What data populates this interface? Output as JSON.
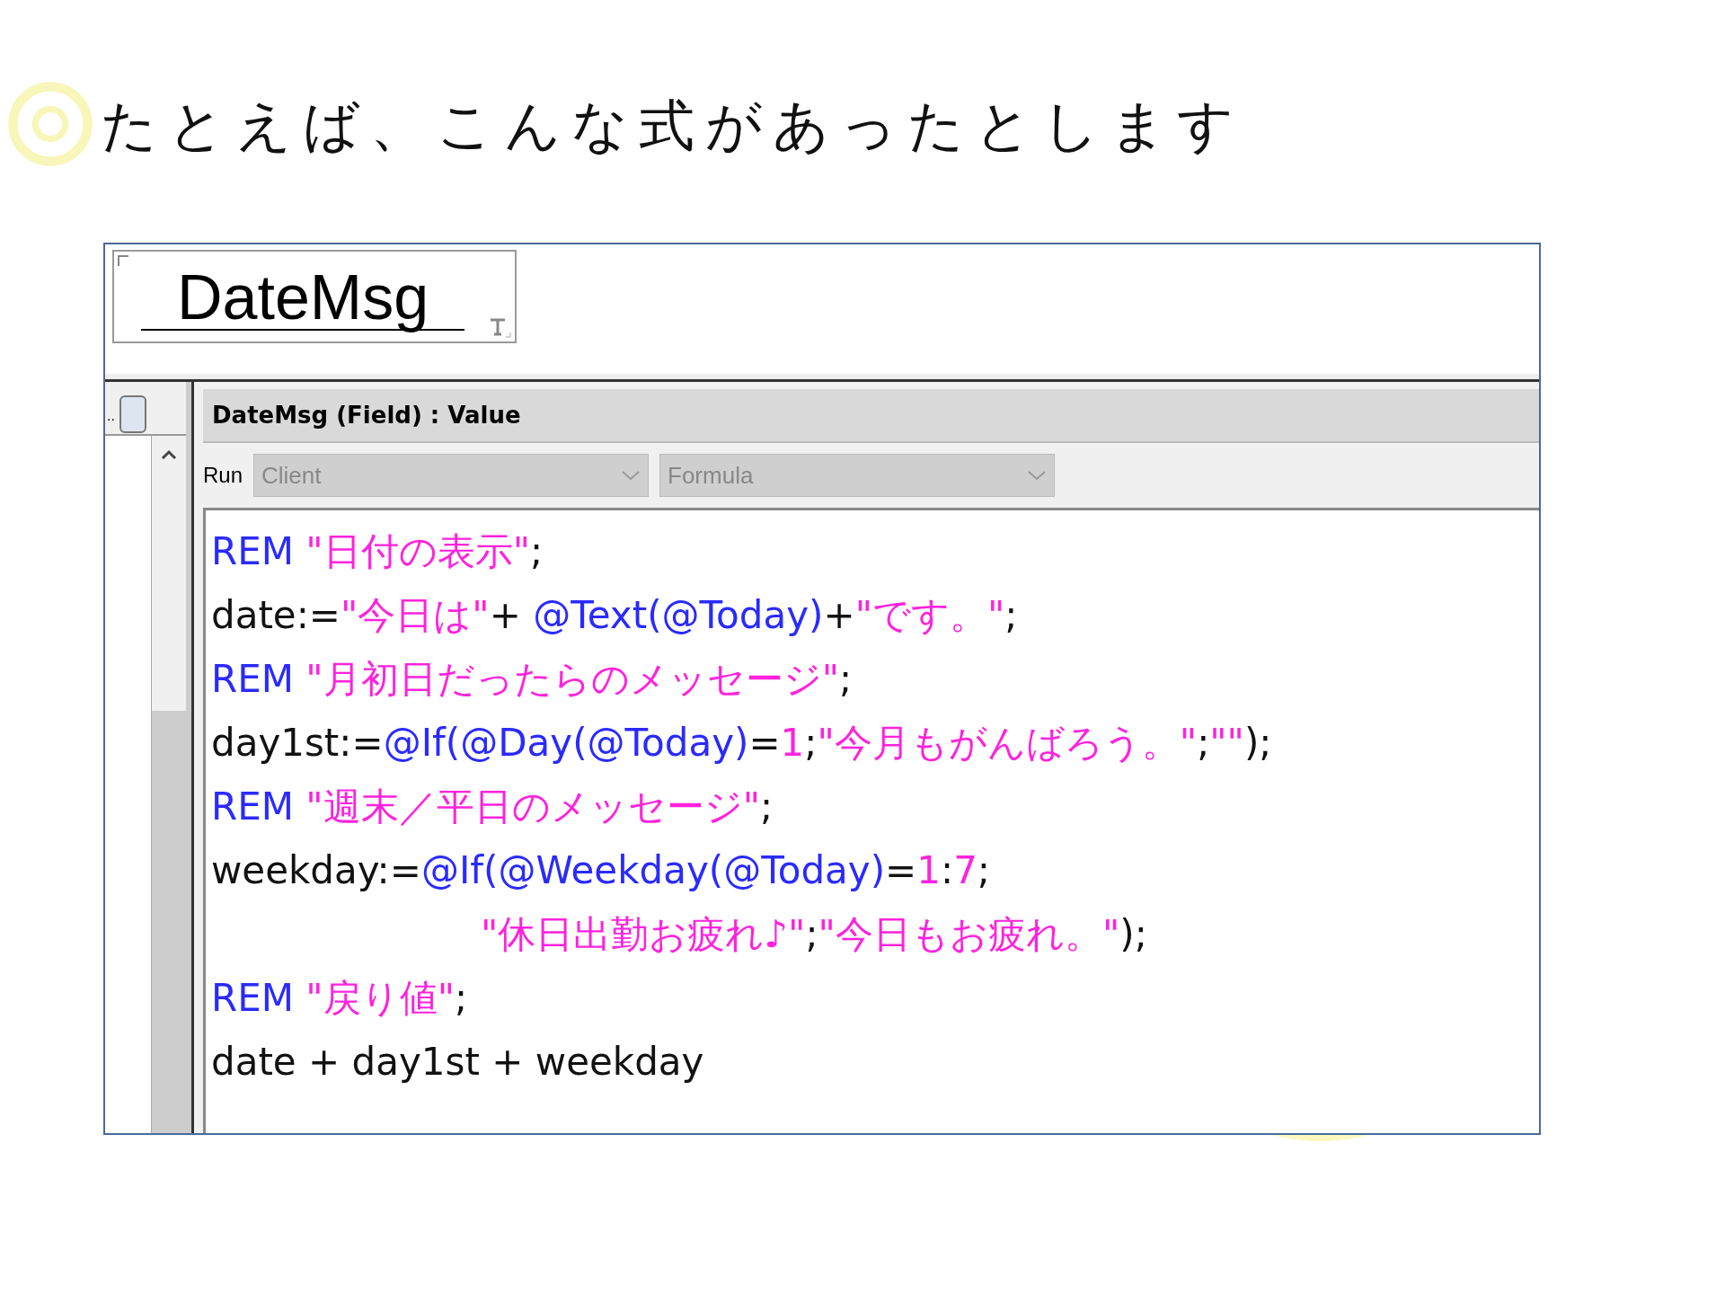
{
  "heading": "たとえば、こんな式があったとします",
  "form": {
    "field_label": "DateMsg"
  },
  "left_pane": {
    "tab_label": ".."
  },
  "panel": {
    "title": "DateMsg (Field) : Value",
    "run_label": "Run",
    "run_select": "Client",
    "type_select": "Formula"
  },
  "code_lines": [
    [
      {
        "kind": "keyword",
        "text": "REM "
      },
      {
        "kind": "string",
        "text": "\"日付の表示\""
      },
      {
        "kind": "plain",
        "text": ";"
      }
    ],
    [
      {
        "kind": "plain",
        "text": "date:="
      },
      {
        "kind": "string",
        "text": "\"今日は\""
      },
      {
        "kind": "plain",
        "text": "+ "
      },
      {
        "kind": "keyword",
        "text": "@Text(@Today)"
      },
      {
        "kind": "plain",
        "text": "+"
      },
      {
        "kind": "string",
        "text": "\"です。\""
      },
      {
        "kind": "plain",
        "text": ";"
      }
    ],
    [
      {
        "kind": "keyword",
        "text": "REM "
      },
      {
        "kind": "string",
        "text": "\"月初日だったらのメッセージ\""
      },
      {
        "kind": "plain",
        "text": ";"
      }
    ],
    [
      {
        "kind": "plain",
        "text": "day1st:="
      },
      {
        "kind": "keyword",
        "text": "@If(@Day(@Today)"
      },
      {
        "kind": "plain",
        "text": "="
      },
      {
        "kind": "string",
        "text": "1"
      },
      {
        "kind": "plain",
        "text": ";"
      },
      {
        "kind": "string",
        "text": "\"今月もがんばろう。\""
      },
      {
        "kind": "plain",
        "text": ";"
      },
      {
        "kind": "string",
        "text": "\"\""
      },
      {
        "kind": "plain",
        "text": ");"
      }
    ],
    [
      {
        "kind": "keyword",
        "text": "REM "
      },
      {
        "kind": "string",
        "text": "\"週末／平日のメッセージ\""
      },
      {
        "kind": "plain",
        "text": ";"
      }
    ],
    [
      {
        "kind": "plain",
        "text": "weekday:="
      },
      {
        "kind": "keyword",
        "text": "@If(@Weekday(@Today)"
      },
      {
        "kind": "plain",
        "text": "="
      },
      {
        "kind": "string",
        "text": "1"
      },
      {
        "kind": "plain",
        "text": ":"
      },
      {
        "kind": "string",
        "text": "7"
      },
      {
        "kind": "plain",
        "text": ";"
      }
    ],
    [
      {
        "kind": "indent"
      },
      {
        "kind": "string",
        "text": "\"休日出勤お疲れ♪\""
      },
      {
        "kind": "plain",
        "text": ";"
      },
      {
        "kind": "string",
        "text": "\"今日もお疲れ。\""
      },
      {
        "kind": "plain",
        "text": ");"
      }
    ],
    [
      {
        "kind": "keyword",
        "text": "REM "
      },
      {
        "kind": "string",
        "text": "\"戻り値\""
      },
      {
        "kind": "plain",
        "text": ";"
      }
    ],
    [
      {
        "kind": "plain",
        "text": "date + day1st + weekday"
      }
    ]
  ]
}
